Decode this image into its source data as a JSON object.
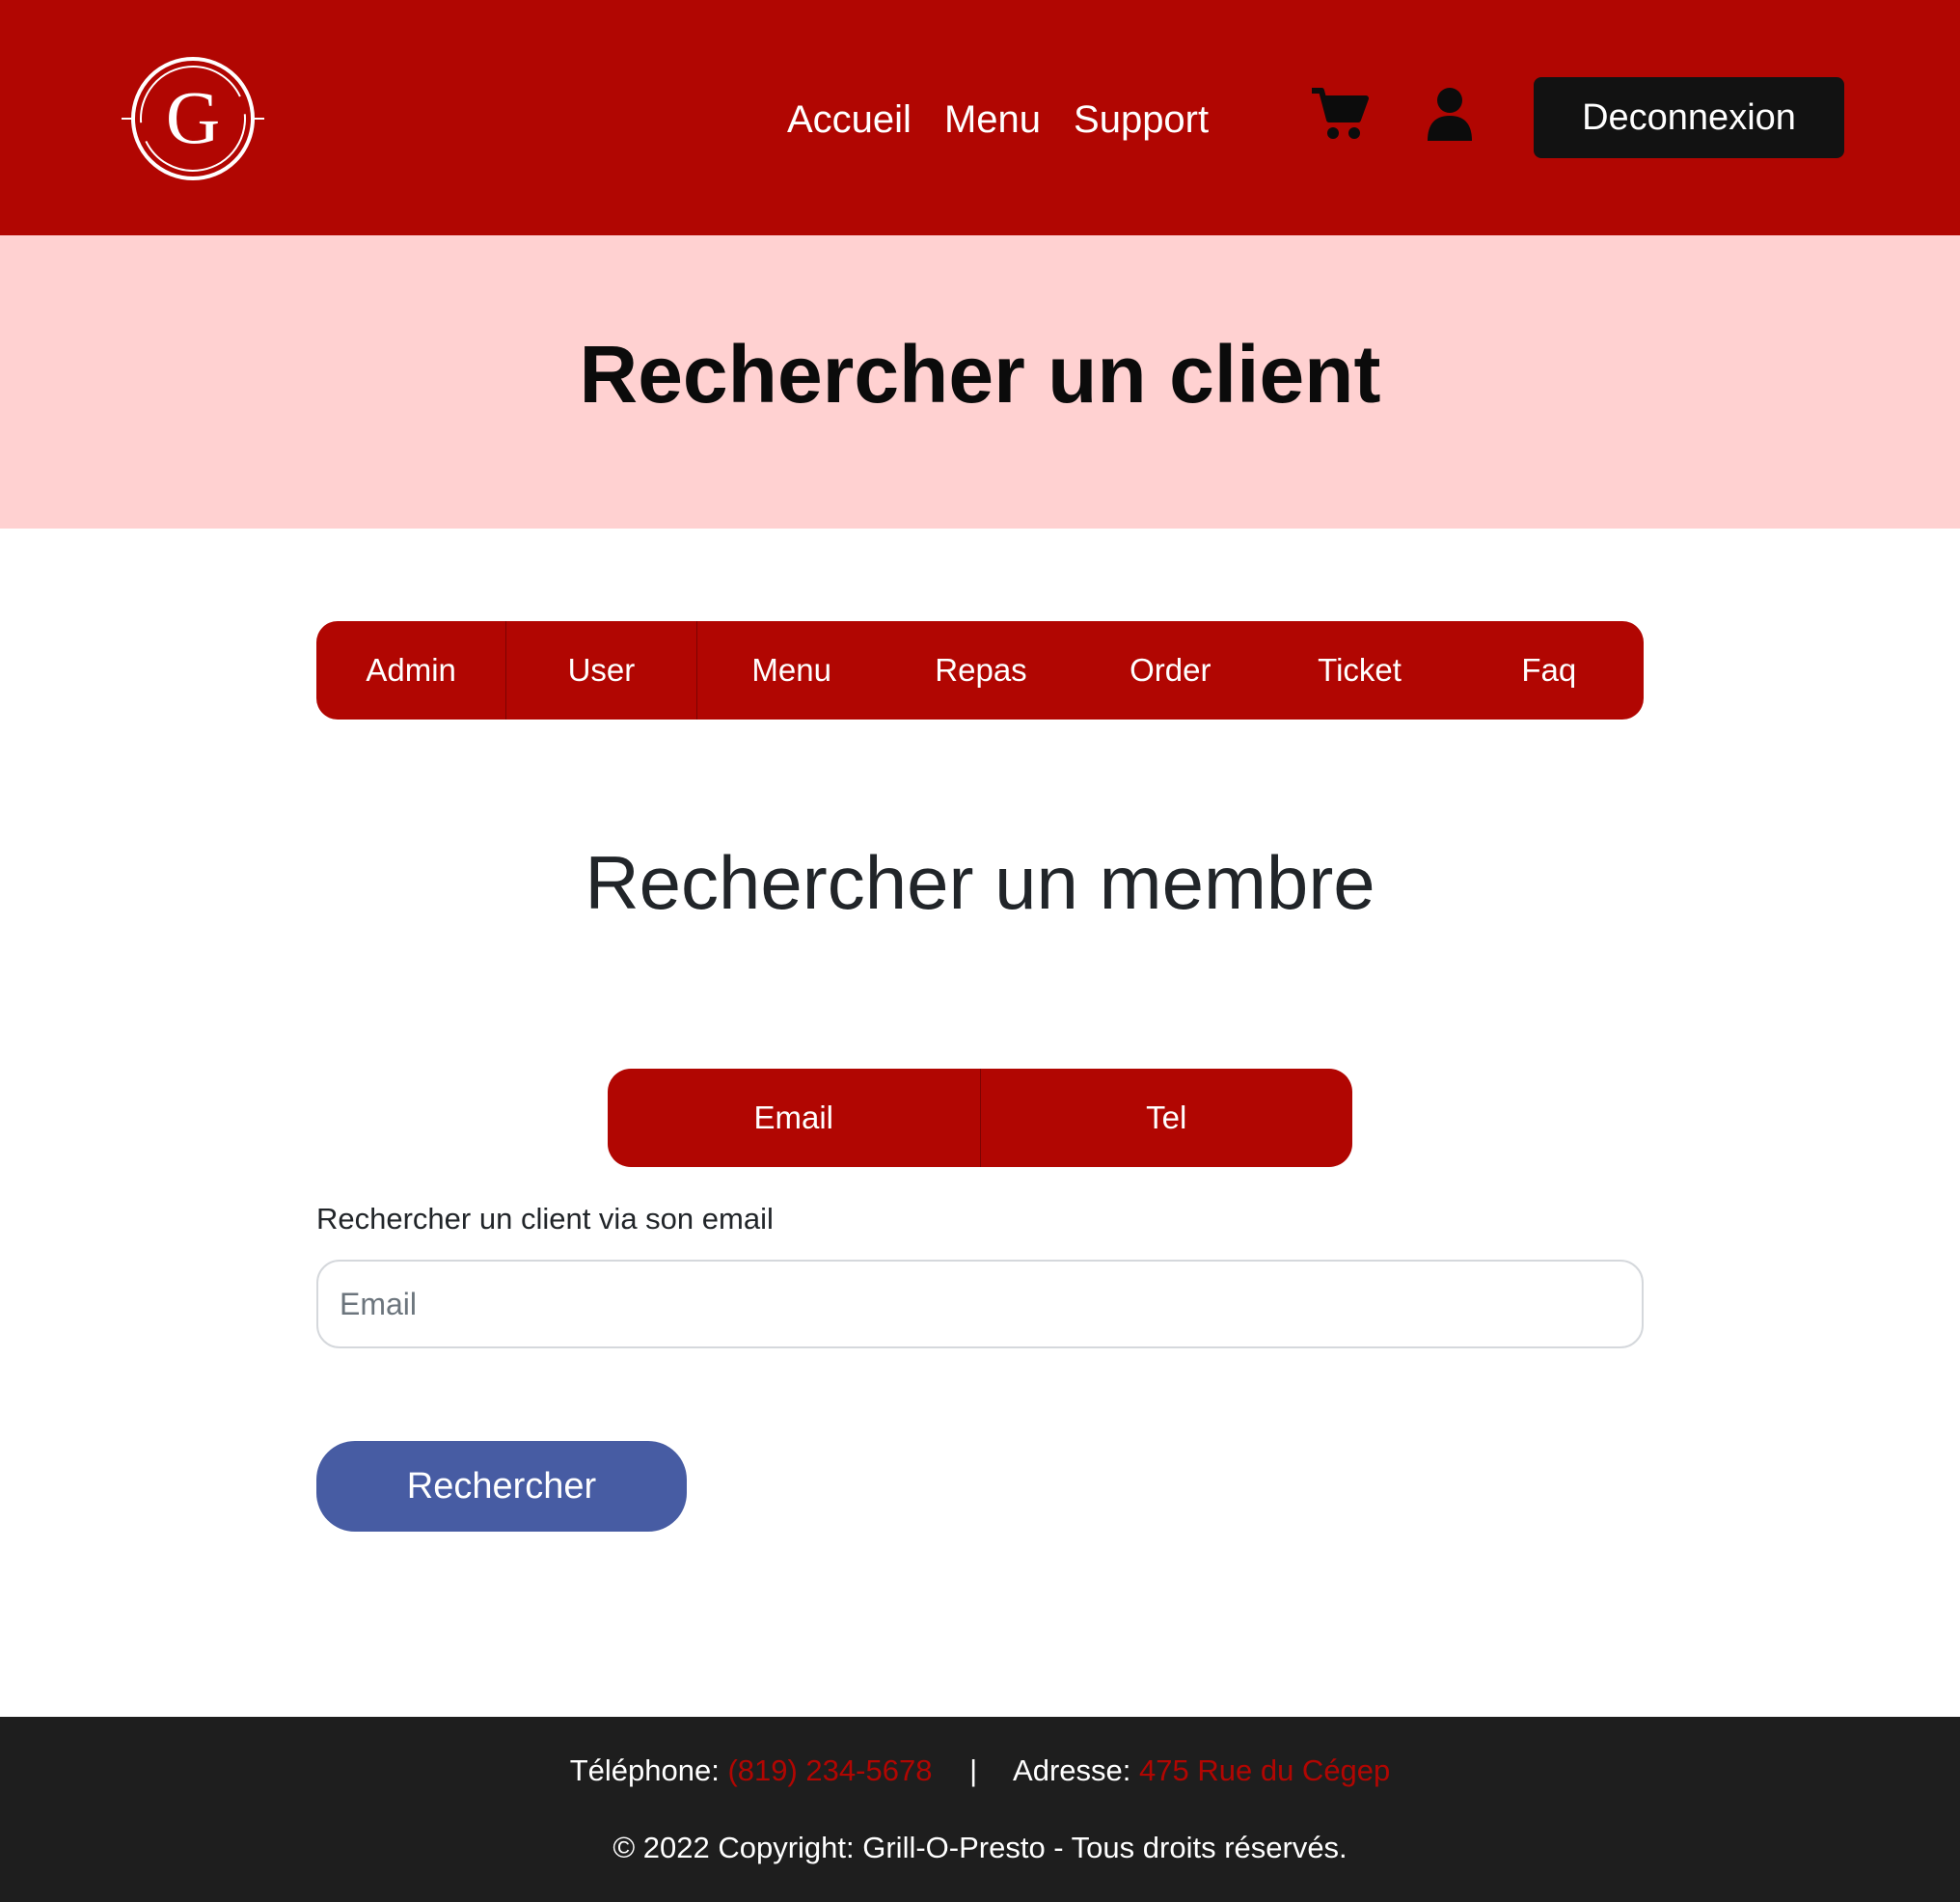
{
  "header": {
    "logo_letter": "G",
    "nav": [
      "Accueil",
      "Menu",
      "Support"
    ],
    "logout_label": "Deconnexion"
  },
  "hero": {
    "title": "Rechercher un client"
  },
  "admin_tabs": [
    "Admin",
    "User",
    "Menu",
    "Repas",
    "Order",
    "Ticket",
    "Faq"
  ],
  "main": {
    "section_title": "Rechercher un membre",
    "search_modes": [
      "Email",
      "Tel"
    ],
    "field_label": "Rechercher un client via son email",
    "input_placeholder": "Email",
    "input_value": "",
    "search_button": "Rechercher"
  },
  "footer": {
    "phone_label": "Téléphone:",
    "phone_value": "(819) 234-5678",
    "separator": "|",
    "address_label": "Adresse:",
    "address_value": "475 Rue du Cégep",
    "copyright": "© 2022 Copyright: Grill-O-Presto - Tous droits réservés."
  },
  "colors": {
    "brand_red": "#b10602",
    "hero_pink": "#ffd1d1",
    "button_blue": "#475ca3",
    "footer_dark": "#1e1e1e"
  },
  "icons": [
    "logo-icon",
    "cart-icon",
    "user-icon"
  ]
}
